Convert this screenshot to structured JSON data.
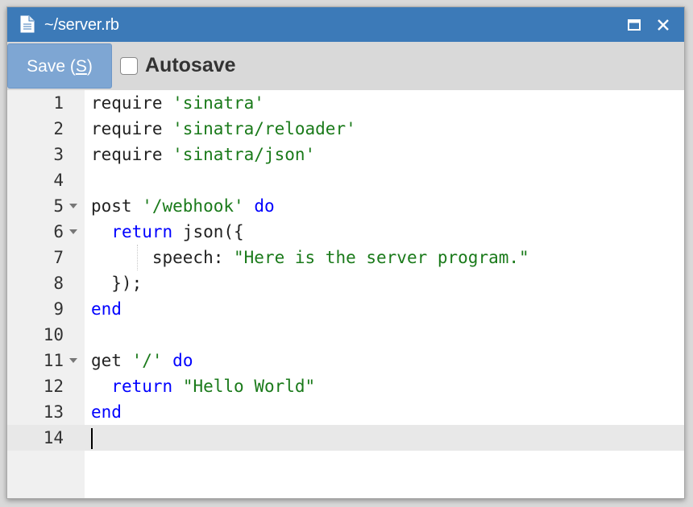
{
  "window": {
    "title": "~/server.rb"
  },
  "toolbar": {
    "save_label_prefix": "Save (",
    "save_label_key": "S",
    "save_label_suffix": ")",
    "autosave_label": "Autosave",
    "autosave_checked": false
  },
  "editor": {
    "language": "ruby",
    "active_line": 14,
    "lines": [
      {
        "number": "1",
        "foldable": false,
        "tokens": [
          {
            "type": "plain",
            "text": "require "
          },
          {
            "type": "string",
            "text": "'sinatra'"
          }
        ]
      },
      {
        "number": "2",
        "foldable": false,
        "tokens": [
          {
            "type": "plain",
            "text": "require "
          },
          {
            "type": "string",
            "text": "'sinatra/reloader'"
          }
        ]
      },
      {
        "number": "3",
        "foldable": false,
        "tokens": [
          {
            "type": "plain",
            "text": "require "
          },
          {
            "type": "string",
            "text": "'sinatra/json'"
          }
        ]
      },
      {
        "number": "4",
        "foldable": false,
        "tokens": []
      },
      {
        "number": "5",
        "foldable": true,
        "tokens": [
          {
            "type": "plain",
            "text": "post "
          },
          {
            "type": "string",
            "text": "'/webhook'"
          },
          {
            "type": "plain",
            "text": " "
          },
          {
            "type": "keyword",
            "text": "do"
          }
        ]
      },
      {
        "number": "6",
        "foldable": true,
        "tokens": [
          {
            "type": "plain",
            "text": "  "
          },
          {
            "type": "keyword",
            "text": "return"
          },
          {
            "type": "plain",
            "text": " json({"
          }
        ]
      },
      {
        "number": "7",
        "foldable": false,
        "indent_guide": true,
        "tokens": [
          {
            "type": "plain",
            "text": "      speech: "
          },
          {
            "type": "string",
            "text": "\"Here is the server program.\""
          }
        ]
      },
      {
        "number": "8",
        "foldable": false,
        "tokens": [
          {
            "type": "plain",
            "text": "  });"
          }
        ]
      },
      {
        "number": "9",
        "foldable": false,
        "tokens": [
          {
            "type": "keyword",
            "text": "end"
          }
        ]
      },
      {
        "number": "10",
        "foldable": false,
        "tokens": []
      },
      {
        "number": "11",
        "foldable": true,
        "tokens": [
          {
            "type": "plain",
            "text": "get "
          },
          {
            "type": "string",
            "text": "'/'"
          },
          {
            "type": "plain",
            "text": " "
          },
          {
            "type": "keyword",
            "text": "do"
          }
        ]
      },
      {
        "number": "12",
        "foldable": false,
        "tokens": [
          {
            "type": "plain",
            "text": "  "
          },
          {
            "type": "keyword",
            "text": "return"
          },
          {
            "type": "plain",
            "text": " "
          },
          {
            "type": "string",
            "text": "\"Hello World\""
          }
        ]
      },
      {
        "number": "13",
        "foldable": false,
        "tokens": [
          {
            "type": "keyword",
            "text": "end"
          }
        ]
      },
      {
        "number": "14",
        "foldable": false,
        "tokens": []
      }
    ]
  },
  "colors": {
    "titlebar": "#3c7ab8",
    "save_button": "#7ea6d3",
    "keyword": "#0000ff",
    "string": "#1a7a1a",
    "active_line": "#e8e8e8"
  },
  "icons": {
    "file": "file-icon",
    "maximize": "maximize-icon",
    "close": "close-icon",
    "fold": "fold-arrow-icon"
  }
}
